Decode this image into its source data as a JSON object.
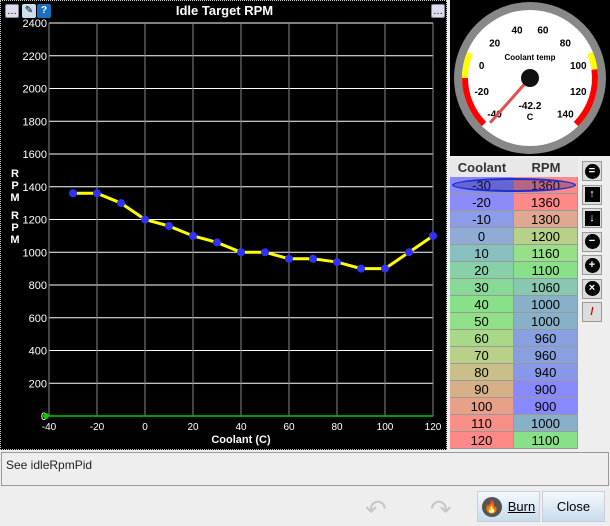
{
  "title": "Idle Target RPM",
  "chart_data": {
    "type": "line",
    "title": "Idle Target RPM",
    "xlabel": "Coolant (C)",
    "ylabel": "RPM",
    "xlim": [
      -40,
      120
    ],
    "ylim": [
      0,
      2400
    ],
    "x_ticks": [
      -40,
      -20,
      0,
      20,
      40,
      60,
      80,
      100,
      120
    ],
    "y_ticks": [
      0,
      200,
      400,
      600,
      800,
      1000,
      1200,
      1400,
      1600,
      1800,
      2000,
      2200,
      2400
    ],
    "x": [
      -30,
      -20,
      -10,
      0,
      10,
      20,
      30,
      40,
      50,
      60,
      70,
      80,
      90,
      100,
      110,
      120
    ],
    "y": [
      1360,
      1360,
      1300,
      1200,
      1160,
      1100,
      1060,
      1000,
      1000,
      960,
      960,
      940,
      900,
      900,
      1000,
      1100
    ]
  },
  "gauge": {
    "title": "Coolant temp",
    "value": "-42.2",
    "unit": "C",
    "min": -40,
    "max": 140,
    "labels": [
      "-40",
      "-20",
      "0",
      "20",
      "40",
      "60",
      "80",
      "100",
      "120",
      "140"
    ],
    "needle_value": -42.2
  },
  "table": {
    "headers": [
      "Coolant",
      "RPM"
    ],
    "rows": [
      {
        "c": "-30",
        "r": "1360",
        "cc": "#8888ff",
        "rc": "#ff8888"
      },
      {
        "c": "-20",
        "r": "1360",
        "cc": "#8c8cf8",
        "rc": "#ff8888"
      },
      {
        "c": "-10",
        "r": "1300",
        "cc": "#8c9ce8",
        "rc": "#e0a890"
      },
      {
        "c": "0",
        "r": "1200",
        "cc": "#90acd4",
        "rc": "#b8d088"
      },
      {
        "c": "10",
        "r": "1160",
        "cc": "#88c0c0",
        "rc": "#98e088"
      },
      {
        "c": "20",
        "r": "1100",
        "cc": "#88d0a8",
        "rc": "#88e088"
      },
      {
        "c": "30",
        "r": "1060",
        "cc": "#88d898",
        "rc": "#88c8b0"
      },
      {
        "c": "40",
        "r": "1000",
        "cc": "#88e088",
        "rc": "#88b0c8"
      },
      {
        "c": "50",
        "r": "1000",
        "cc": "#90e088",
        "rc": "#88b0c8"
      },
      {
        "c": "60",
        "r": "960",
        "cc": "#a8d888",
        "rc": "#88a0e0"
      },
      {
        "c": "70",
        "r": "960",
        "cc": "#b8d088",
        "rc": "#88a0e0"
      },
      {
        "c": "80",
        "r": "940",
        "cc": "#c8c088",
        "rc": "#8898e8"
      },
      {
        "c": "90",
        "r": "900",
        "cc": "#d8b088",
        "rc": "#8888ff"
      },
      {
        "c": "100",
        "r": "900",
        "cc": "#e8a088",
        "rc": "#8888ff"
      },
      {
        "c": "110",
        "r": "1000",
        "cc": "#f89088",
        "rc": "#88b0c8"
      },
      {
        "c": "120",
        "r": "1100",
        "cc": "#ff8888",
        "rc": "#88e088"
      }
    ]
  },
  "note": "See idleRpmPid",
  "buttons": {
    "burn": "Burn",
    "close": "Close"
  }
}
